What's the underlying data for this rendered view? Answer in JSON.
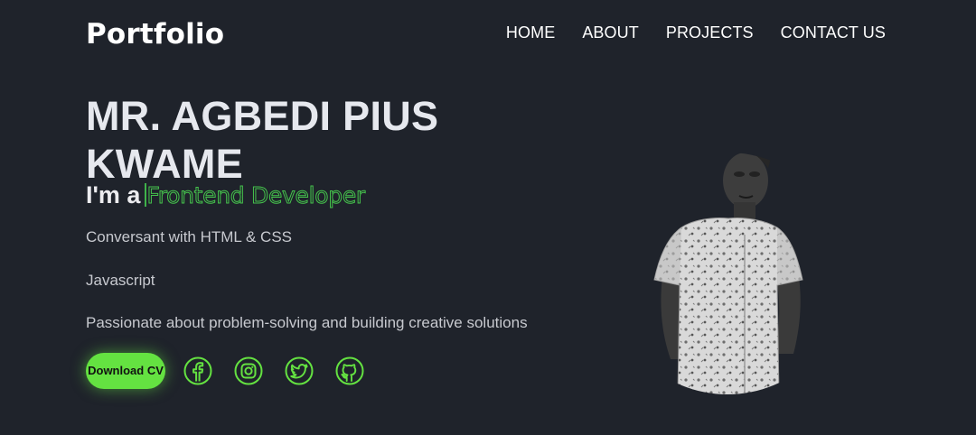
{
  "header": {
    "brand": "Portfolio",
    "nav": [
      {
        "label": "HOME"
      },
      {
        "label": "ABOUT"
      },
      {
        "label": "PROJECTS"
      },
      {
        "label": "CONTACT US"
      }
    ]
  },
  "hero": {
    "name": "MR. AGBEDI PIUS KWAME",
    "intro_prefix": "I'm a",
    "role": "Frontend Developer",
    "skills": [
      "Conversant with HTML & CSS",
      "Javascript",
      "Passionate about problem-solving and building creative solutions"
    ],
    "cv_button": "Download CV",
    "socials": [
      {
        "icon": "facebook-icon"
      },
      {
        "icon": "instagram-icon"
      },
      {
        "icon": "twitter-icon"
      },
      {
        "icon": "github-icon"
      }
    ]
  },
  "colors": {
    "background": "#1f232b",
    "accent": "#64e241",
    "typed_text": "#45c24c"
  }
}
